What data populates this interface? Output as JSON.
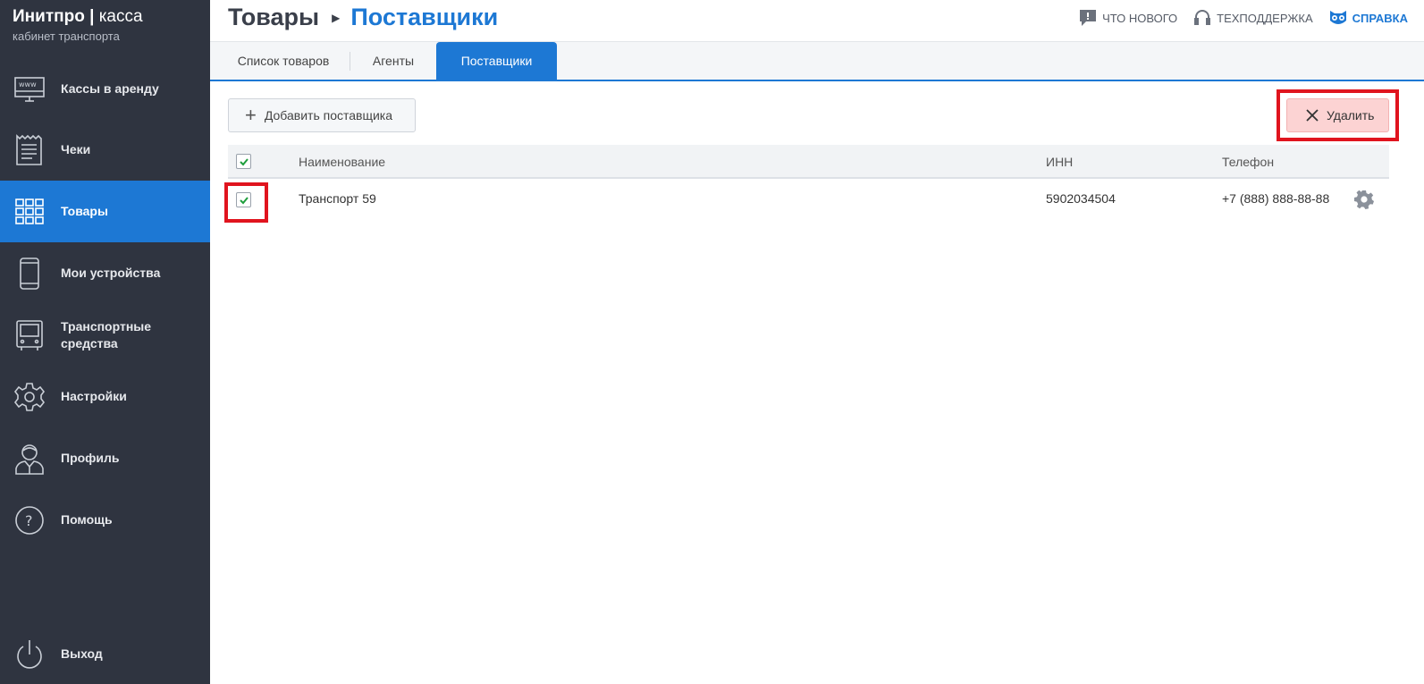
{
  "brand": {
    "name_bold": "Инитпро",
    "name_light": "касса",
    "subtitle": "кабинет транспорта"
  },
  "sidebar": {
    "items": [
      {
        "label": "Кассы в аренду",
        "icon": "monitor-www-icon",
        "active": false
      },
      {
        "label": "Чеки",
        "icon": "receipt-icon",
        "active": false
      },
      {
        "label": "Товары",
        "icon": "grid-icon",
        "active": true
      },
      {
        "label": "Мои устройства",
        "icon": "phone-icon",
        "active": false
      },
      {
        "label": "Транспортные средства",
        "icon": "bus-icon",
        "active": false
      },
      {
        "label": "Настройки",
        "icon": "gear-icon",
        "active": false
      },
      {
        "label": "Профиль",
        "icon": "user-icon",
        "active": false
      },
      {
        "label": "Помощь",
        "icon": "question-icon",
        "active": false
      }
    ],
    "logout_label": "Выход"
  },
  "header": {
    "breadcrumb_parent": "Товары",
    "breadcrumb_current": "Поставщики",
    "links": {
      "whats_new": "ЧТО НОВОГО",
      "support": "ТЕХПОДДЕРЖКА",
      "help": "СПРАВКА"
    }
  },
  "tabs": [
    {
      "label": "Список товаров",
      "active": false
    },
    {
      "label": "Агенты",
      "active": false
    },
    {
      "label": "Поставщики",
      "active": true
    }
  ],
  "toolbar": {
    "add_label": "Добавить поставщика",
    "delete_label": "Удалить"
  },
  "table": {
    "headers": {
      "name": "Наименование",
      "inn": "ИНН",
      "phone": "Телефон"
    },
    "select_all_checked": true,
    "rows": [
      {
        "checked": true,
        "name": "Транспорт 59",
        "inn": "5902034504",
        "phone": "+7 (888) 888-88-88"
      }
    ]
  },
  "colors": {
    "sidebar_bg": "#2f3440",
    "accent": "#1d78d4",
    "delete_bg": "#fcd3d3",
    "highlight": "#e0141e"
  }
}
